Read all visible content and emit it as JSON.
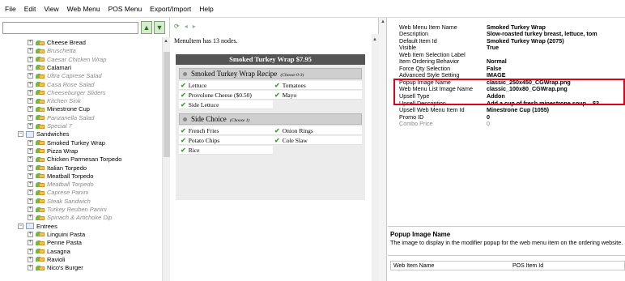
{
  "menubar": {
    "items": [
      "File",
      "Edit",
      "View",
      "Web Menu",
      "POS Menu",
      "Export/Import",
      "Help"
    ]
  },
  "icons": {
    "up": "arrow-up-icon",
    "down": "arrow-down-icon",
    "refresh": "refresh-icon",
    "collapse": "collapse-icon",
    "expand": "expand-icon"
  },
  "tree": {
    "items": [
      {
        "label": "Cheese Bread",
        "dim": false
      },
      {
        "label": "Bruschetta",
        "dim": true
      },
      {
        "label": "Caesar Chicken Wrap",
        "dim": true
      },
      {
        "label": "Calamari",
        "dim": false
      },
      {
        "label": "Ultra Caprese Salad",
        "dim": true
      },
      {
        "label": "Casa Rose Salad",
        "dim": true
      },
      {
        "label": "Cheeseburger Sliders",
        "dim": true
      },
      {
        "label": "Kitchen Sink",
        "dim": true
      },
      {
        "label": "Minestrone Cup",
        "dim": false
      },
      {
        "label": "Panzanella Salad",
        "dim": true
      },
      {
        "label": "Special 7",
        "dim": true
      },
      {
        "label": "Sandwiches",
        "category": true
      },
      {
        "label": "Smoked Turkey Wrap",
        "dim": false
      },
      {
        "label": "Pizza Wrap",
        "dim": false
      },
      {
        "label": "Chicken Parmesan Torpedo",
        "dim": false
      },
      {
        "label": "Italian Torpedo",
        "dim": false
      },
      {
        "label": "Meatball Torpedo",
        "dim": false
      },
      {
        "label": "Meatball Torpedo",
        "dim": true
      },
      {
        "label": "Caprese Panini",
        "dim": true
      },
      {
        "label": "Steak Sandwich",
        "dim": true
      },
      {
        "label": "Turkey Reuben Panini",
        "dim": true
      },
      {
        "label": "Spinach & Artichoke Dip",
        "dim": true
      },
      {
        "label": "Entrees",
        "category": true
      },
      {
        "label": "Linguini Pasta",
        "dim": false
      },
      {
        "label": "Penne Pasta",
        "dim": false
      },
      {
        "label": "Lasagna",
        "dim": false
      },
      {
        "label": "Ravioli",
        "dim": false
      },
      {
        "label": "Nico's Burger",
        "dim": false
      }
    ]
  },
  "middle": {
    "node_count": "MenuItem has 13 nodes.",
    "recipe_title": "Smoked Turkey Wrap $7.95",
    "groups": [
      {
        "title": "Smoked Turkey Wrap Recipe",
        "hint": "(Choose 0-3)",
        "options": [
          "Lettuce",
          "Tomatoes",
          "Provolone Cheese ($0.50)",
          "Mayo",
          "Side Lettuce"
        ]
      },
      {
        "title": "Side Choice",
        "hint": "(Choose 1)",
        "options": [
          "French Fries",
          "Onion Rings",
          "Potato Chips",
          "Cole Slaw",
          "Rice"
        ]
      }
    ]
  },
  "properties": [
    {
      "name": "Web Menu Item Name",
      "value": "Smoked Turkey Wrap",
      "dim": false
    },
    {
      "name": "Description",
      "value": "Slow-roasted turkey breast, lettuce, tom",
      "dim": false
    },
    {
      "name": "Default Item Id",
      "value": "Smoked Turkey Wrap (2075)",
      "dim": false
    },
    {
      "name": "Visible",
      "value": "True",
      "dim": false
    },
    {
      "name": "Web Item Selection Label",
      "value": "",
      "dim": false
    },
    {
      "name": "Item Ordering Behavior",
      "value": "Normal",
      "dim": false
    },
    {
      "name": "Force Qty Selection",
      "value": "False",
      "dim": false
    },
    {
      "name": "Advanced Style Setting",
      "value": "IMAGE",
      "dim": false
    },
    {
      "name": "Popup Image Name",
      "value": "classic_250x450_CGWrap.png",
      "dim": false
    },
    {
      "name": "Web Menu List Image Name",
      "value": "classic_100x80_CGWrap.png",
      "dim": false
    },
    {
      "name": "Upsell Type",
      "value": "Addon",
      "dim": false
    },
    {
      "name": "Upsell Description",
      "value": "Add a cup of fresh minestrone soup... $3",
      "dim": false
    },
    {
      "name": "Upsell Web Menu Item Id",
      "value": "Minestrone Cup (1055)",
      "dim": false
    },
    {
      "name": "Promo ID",
      "value": "0",
      "dim": false
    },
    {
      "name": "Combo Price",
      "value": "0",
      "dim": true
    }
  ],
  "help": {
    "title": "Popup Image Name",
    "description": "The image to display in the modifier popup for the web menu item on the ordering website."
  },
  "bottom_grid": {
    "columns": [
      "Web Item Name",
      "POS Item Id"
    ]
  },
  "colors": {
    "highlight": "#e0001b",
    "recipe_header": "#555555",
    "check": "#3e9d2e"
  }
}
